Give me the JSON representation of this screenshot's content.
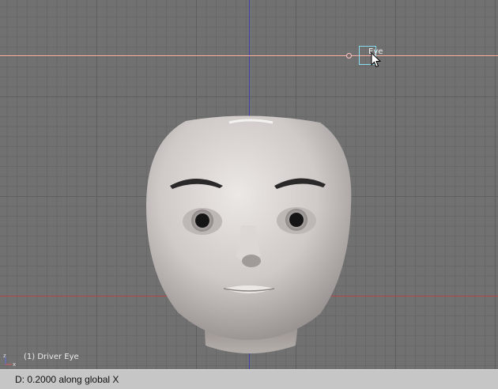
{
  "viewport": {
    "object_name": "Eye",
    "frame_info": "(1) Driver Eye",
    "axes": {
      "x_label": "x",
      "z_label": "z"
    }
  },
  "statusbar": {
    "transform_text": "D: 0.2000 along global X"
  },
  "colors": {
    "grid_background": "#717171",
    "x_axis": "#b04848",
    "z_axis": "#4040b0",
    "constraint_line": "#ffb0a0",
    "selection": "#88ddee"
  },
  "icons": {
    "cursor": "arrow-pointer-icon",
    "axis": "xz-axis-gizmo-icon"
  }
}
